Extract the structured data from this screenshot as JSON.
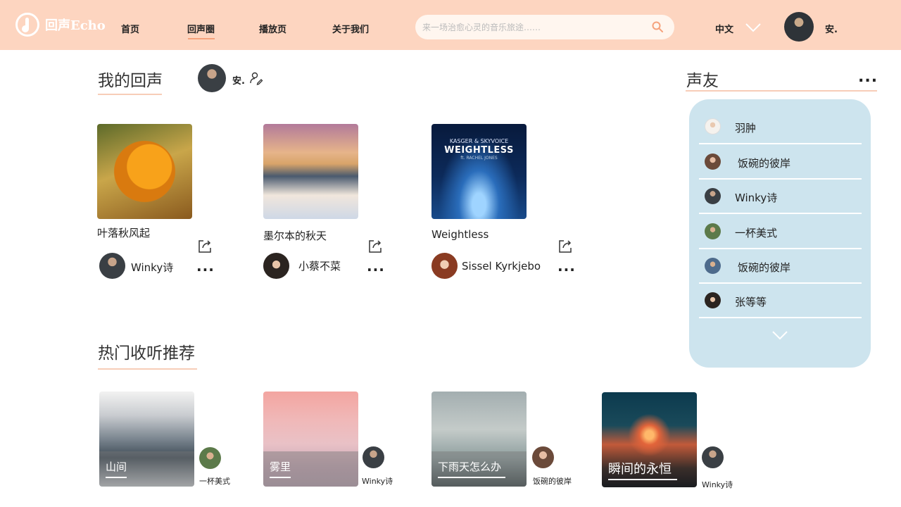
{
  "header": {
    "logo_text": "回声Echo",
    "nav": [
      "首页",
      "回声圈",
      "播放页",
      "关于我们"
    ],
    "search_placeholder": "来一场治愈心灵的音乐旅途……",
    "language": "中文",
    "user_name": "安."
  },
  "my_echo": {
    "title": "我的回声",
    "user_name": "安.",
    "cards": [
      {
        "title": "叶落秋风起",
        "artist": "Winky诗",
        "more": "..."
      },
      {
        "title": "墨尔本的秋天",
        "artist": "小蔡不菜",
        "more": "..."
      },
      {
        "title": "Weightless",
        "artist": "Sissel Kyrkjebo",
        "more": "...",
        "cover_text": {
          "top": "KASGER & SKYVOICE",
          "main": "WEIGHTLESS",
          "sub": "ft. RACHEL JONES"
        }
      }
    ]
  },
  "friends": {
    "title": "声友",
    "more": "...",
    "items": [
      "羽肿",
      "饭碗的彼岸",
      "Winky诗",
      "一杯美式",
      "饭碗的彼岸",
      "张等等"
    ]
  },
  "hot": {
    "title": "热门收听推荐",
    "cards": [
      {
        "label": "山间",
        "user": "一杯美式"
      },
      {
        "label": "雾里",
        "user": "Winky诗"
      },
      {
        "label": "下雨天怎么办",
        "user": "饭碗的彼岸"
      },
      {
        "label": "瞬间的永恒",
        "user": "Winky诗"
      }
    ]
  },
  "colors": {
    "header_bg": "#fdd5c0",
    "accent": "#f5a27c",
    "panel_bg": "#cde4ee"
  }
}
